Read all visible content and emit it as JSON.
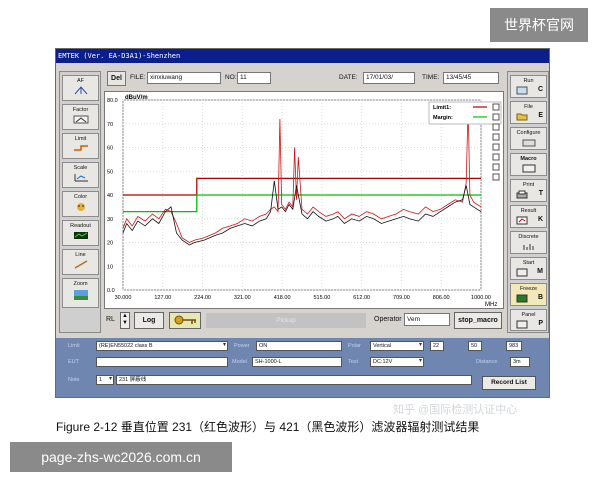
{
  "watermark_top": "世界杯官网",
  "watermark_bottom": "page-zhs-wc2026.com.cn",
  "zhihu_watermark": "知乎 @国际检测认证中心",
  "window": {
    "title": "EMTEK (Ver. EA-D3A1)-Shenzhen",
    "toolbar": {
      "del": "Del",
      "file_label": "FILE:",
      "file_value": "xinxiuwang",
      "no_label": "NO:",
      "no_value": "11",
      "date_label": "DATE:",
      "date_value": "17/01/03/",
      "time_label": "TIME:",
      "time_value": "13/45/45"
    },
    "left_tools": [
      "AF",
      "Factor",
      "Limit",
      "Scale",
      "Color",
      "Readout",
      "Line",
      "Zoom"
    ],
    "right_tools": [
      {
        "label": "Run",
        "key": "C"
      },
      {
        "label": "File",
        "key": "E"
      },
      {
        "label": "Configure",
        "key": ""
      },
      {
        "label": "Macro",
        "key": ""
      },
      {
        "label": "Print",
        "key": "T"
      },
      {
        "label": "Result",
        "key": "K"
      },
      {
        "label": "Discrete",
        "key": ""
      },
      {
        "label": "Start",
        "key": "M"
      },
      {
        "label": "Freeze",
        "key": "B"
      },
      {
        "label": "Panel",
        "key": "P"
      }
    ],
    "bottom": {
      "rl": "RL",
      "log": "Log",
      "status": "Pickup",
      "operator_label": "Operator",
      "operator_value": "Vem",
      "stop_macro": "stop_macro"
    },
    "params": {
      "standard": "(RE)EN55022 class B",
      "power": "ON",
      "polarity": "Vertical",
      "temp": "22",
      "humidity": "50",
      "pressure": "983",
      "antenna": "SH-1000-L",
      "voltage": "DC:12V",
      "distance": "3m",
      "rows_value": "1",
      "note": "231 屏蔽线",
      "record_list": "Record List"
    }
  },
  "chart_data": {
    "type": "line",
    "ylabel": "dBuV/m",
    "ylim": [
      0,
      80
    ],
    "yticks": [
      "80.0",
      "70",
      "60",
      "50",
      "40",
      "30",
      "20",
      "10",
      "0.0"
    ],
    "xticks": [
      "30.000",
      "127.00",
      "224.00",
      "321.00",
      "418.00",
      "515.00",
      "612.00",
      "709.00",
      "806.00",
      "1000.00"
    ],
    "xunit": "MHz",
    "xlim": [
      30,
      1000
    ],
    "legend": [
      {
        "name": "Limit1:",
        "color": "#b40000"
      },
      {
        "name": "Margin:",
        "color": "#00c000"
      }
    ],
    "limit1": {
      "x": [
        30,
        230,
        230,
        1000
      ],
      "y": [
        40,
        40,
        47,
        47
      ]
    },
    "margin": {
      "x": [
        30,
        230,
        230,
        1000
      ],
      "y": [
        33,
        33,
        40,
        40
      ]
    },
    "series": [
      {
        "color": "#d01414",
        "x": [
          30,
          40,
          55,
          70,
          90,
          110,
          127,
          145,
          160,
          175,
          190,
          210,
          224,
          250,
          280,
          300,
          321,
          340,
          360,
          380,
          400,
          418,
          430,
          440,
          450,
          455,
          460,
          470,
          480,
          490,
          495,
          500,
          505,
          515,
          530,
          545,
          560,
          580,
          600,
          612,
          630,
          650,
          670,
          690,
          709,
          730,
          750,
          770,
          790,
          806,
          830,
          850,
          870,
          890,
          910,
          930,
          950,
          960,
          965,
          970,
          980,
          990,
          1000
        ],
        "y": [
          26,
          30,
          27,
          31,
          29,
          32,
          30,
          34,
          33,
          28,
          22,
          20,
          21,
          22,
          24,
          26,
          27,
          28,
          30,
          29,
          31,
          32,
          34,
          35,
          33,
          72,
          36,
          34,
          37,
          35,
          60,
          38,
          56,
          34,
          32,
          35,
          33,
          31,
          32,
          33,
          30,
          32,
          31,
          33,
          32,
          30,
          31,
          32,
          34,
          33,
          32,
          35,
          33,
          34,
          36,
          38,
          37,
          45,
          78,
          40,
          37,
          36,
          35
        ]
      },
      {
        "color": "#111111",
        "x": [
          30,
          40,
          55,
          70,
          90,
          110,
          127,
          145,
          160,
          175,
          190,
          210,
          224,
          250,
          280,
          300,
          321,
          340,
          360,
          380,
          400,
          418,
          430,
          440,
          450,
          460,
          470,
          480,
          490,
          500,
          515,
          530,
          545,
          560,
          580,
          600,
          612,
          630,
          650,
          670,
          690,
          709,
          730,
          750,
          770,
          790,
          806,
          830,
          850,
          870,
          890,
          910,
          930,
          950,
          960,
          970,
          980,
          990,
          1000
        ],
        "y": [
          24,
          28,
          25,
          29,
          27,
          30,
          28,
          33,
          35,
          24,
          21,
          19,
          20,
          21,
          23,
          24,
          26,
          27,
          28,
          27,
          29,
          30,
          33,
          46,
          34,
          35,
          33,
          36,
          34,
          44,
          32,
          30,
          33,
          31,
          29,
          30,
          31,
          28,
          30,
          29,
          31,
          30,
          28,
          29,
          30,
          31,
          30,
          29,
          32,
          31,
          33,
          35,
          37,
          38,
          44,
          36,
          35,
          34,
          33
        ]
      }
    ]
  },
  "caption": "Figure 2-12  垂直位置 231（红色波形）与 421（黑色波形）滤波器辐射测试结果"
}
